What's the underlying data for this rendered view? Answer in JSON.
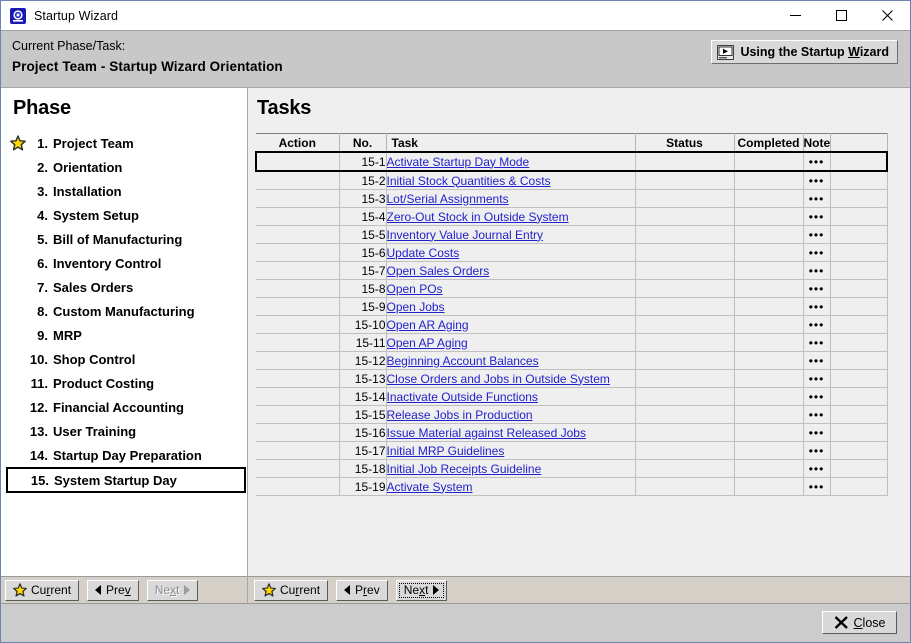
{
  "window": {
    "title": "Startup Wizard",
    "app_icon": "wizard-app-icon",
    "minimize": "–",
    "maximize": "☐",
    "close": "✕"
  },
  "header": {
    "label": "Current Phase/Task:",
    "title": "Project Team - Startup Wizard Orientation",
    "wizard_button": {
      "text_before": "Using the Startup ",
      "accel": "W",
      "text_after": "izard",
      "icon": "video-play-icon"
    }
  },
  "phase_panel": {
    "heading": "Phase",
    "current_marker_icon": "star-icon",
    "items": [
      {
        "num": "1.",
        "name": "Project Team",
        "current": true,
        "selected": false
      },
      {
        "num": "2.",
        "name": "Orientation",
        "current": false,
        "selected": false
      },
      {
        "num": "3.",
        "name": "Installation",
        "current": false,
        "selected": false
      },
      {
        "num": "4.",
        "name": "System Setup",
        "current": false,
        "selected": false
      },
      {
        "num": "5.",
        "name": "Bill of Manufacturing",
        "current": false,
        "selected": false
      },
      {
        "num": "6.",
        "name": "Inventory Control",
        "current": false,
        "selected": false
      },
      {
        "num": "7.",
        "name": "Sales Orders",
        "current": false,
        "selected": false
      },
      {
        "num": "8.",
        "name": "Custom Manufacturing",
        "current": false,
        "selected": false
      },
      {
        "num": "9.",
        "name": "MRP",
        "current": false,
        "selected": false
      },
      {
        "num": "10.",
        "name": "Shop Control",
        "current": false,
        "selected": false
      },
      {
        "num": "11.",
        "name": "Product Costing",
        "current": false,
        "selected": false
      },
      {
        "num": "12.",
        "name": "Financial Accounting",
        "current": false,
        "selected": false
      },
      {
        "num": "13.",
        "name": "User Training",
        "current": false,
        "selected": false
      },
      {
        "num": "14.",
        "name": "Startup Day Preparation",
        "current": false,
        "selected": false
      },
      {
        "num": "15.",
        "name": "System  Startup Day",
        "current": false,
        "selected": true
      }
    ],
    "nav": {
      "current": {
        "label_before": "Cu",
        "accel": "r",
        "label_after": "rent",
        "icon": "star-icon",
        "disabled": false,
        "focused": false
      },
      "prev": {
        "label_before": "Pre",
        "accel": "v",
        "label_after": "",
        "icon": "triangle-left-icon",
        "disabled": false,
        "focused": false
      },
      "next": {
        "label_before": "Ne",
        "accel": "x",
        "label_after": "t",
        "icon": "triangle-right-icon",
        "disabled": true,
        "focused": false
      }
    }
  },
  "tasks_panel": {
    "heading": "Tasks",
    "columns": [
      "Action",
      "No.",
      "Task",
      "Status",
      "Completed",
      "Note",
      ""
    ],
    "note_glyph": "•••",
    "rows": [
      {
        "action": "",
        "no": "15-1",
        "task": "Activate Startup Day Mode",
        "status": "",
        "completed": "",
        "note": true,
        "selected": true
      },
      {
        "action": "",
        "no": "15-2",
        "task": "Initial Stock Quantities & Costs",
        "status": "",
        "completed": "",
        "note": true,
        "selected": false
      },
      {
        "action": "",
        "no": "15-3",
        "task": "Lot/Serial Assignments",
        "status": "",
        "completed": "",
        "note": true,
        "selected": false
      },
      {
        "action": "",
        "no": "15-4",
        "task": "Zero-Out Stock in Outside System",
        "status": "",
        "completed": "",
        "note": true,
        "selected": false
      },
      {
        "action": "",
        "no": "15-5",
        "task": "Inventory Value Journal Entry",
        "status": "",
        "completed": "",
        "note": true,
        "selected": false
      },
      {
        "action": "",
        "no": "15-6",
        "task": "Update Costs",
        "status": "",
        "completed": "",
        "note": true,
        "selected": false
      },
      {
        "action": "",
        "no": "15-7",
        "task": "Open Sales Orders",
        "status": "",
        "completed": "",
        "note": true,
        "selected": false
      },
      {
        "action": "",
        "no": "15-8",
        "task": "Open POs",
        "status": "",
        "completed": "",
        "note": true,
        "selected": false
      },
      {
        "action": "",
        "no": "15-9",
        "task": "Open Jobs",
        "status": "",
        "completed": "",
        "note": true,
        "selected": false
      },
      {
        "action": "",
        "no": "15-10",
        "task": "Open AR Aging",
        "status": "",
        "completed": "",
        "note": true,
        "selected": false
      },
      {
        "action": "",
        "no": "15-11",
        "task": "Open AP Aging",
        "status": "",
        "completed": "",
        "note": true,
        "selected": false
      },
      {
        "action": "",
        "no": "15-12",
        "task": "Beginning Account Balances",
        "status": "",
        "completed": "",
        "note": true,
        "selected": false
      },
      {
        "action": "",
        "no": "15-13",
        "task": "Close Orders and Jobs in Outside System",
        "status": "",
        "completed": "",
        "note": true,
        "selected": false
      },
      {
        "action": "",
        "no": "15-14",
        "task": "Inactivate Outside Functions",
        "status": "",
        "completed": "",
        "note": true,
        "selected": false
      },
      {
        "action": "",
        "no": "15-15",
        "task": "Release Jobs in Production",
        "status": "",
        "completed": "",
        "note": true,
        "selected": false
      },
      {
        "action": "",
        "no": "15-16",
        "task": "Issue Material against Released Jobs",
        "status": "",
        "completed": "",
        "note": true,
        "selected": false
      },
      {
        "action": "",
        "no": "15-17",
        "task": "Initial MRP Guidelines",
        "status": "",
        "completed": "",
        "note": true,
        "selected": false
      },
      {
        "action": "",
        "no": "15-18",
        "task": "Initial Job Receipts Guideline",
        "status": "",
        "completed": "",
        "note": true,
        "selected": false
      },
      {
        "action": "",
        "no": "15-19",
        "task": "Activate System",
        "status": "",
        "completed": "",
        "note": true,
        "selected": false
      }
    ],
    "nav": {
      "current": {
        "label_before": "Cu",
        "accel": "r",
        "label_after": "rent",
        "icon": "star-icon",
        "disabled": false,
        "focused": false
      },
      "prev": {
        "label_before": "P",
        "accel": "r",
        "label_after": "ev",
        "icon": "triangle-left-icon",
        "disabled": false,
        "focused": false
      },
      "next": {
        "label_before": "Ne",
        "accel": "x",
        "label_after": "t",
        "icon": "triangle-right-icon",
        "disabled": false,
        "focused": true
      }
    }
  },
  "footer": {
    "close": {
      "label_before": "",
      "accel": "C",
      "label_after": "lose",
      "icon": "x-icon"
    }
  },
  "colors": {
    "link": "#2222cc",
    "header_bg": "#c8c8c8",
    "panel_bg": "#efefef",
    "chrome_bg": "#d4d0c8",
    "star_fill": "#ffd800",
    "accent_blue": "#1a1ab4"
  }
}
